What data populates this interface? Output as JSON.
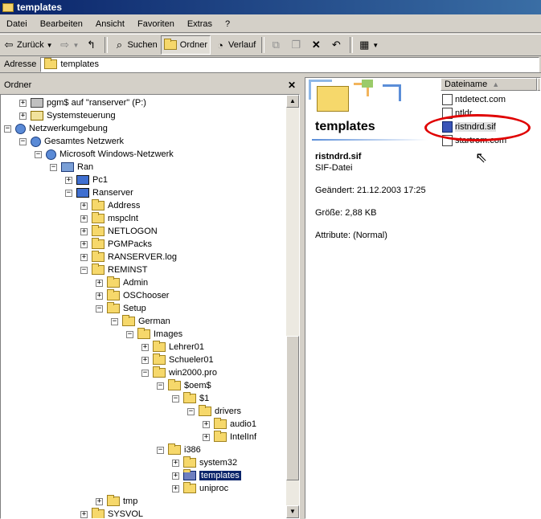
{
  "window": {
    "title": "templates"
  },
  "menu": [
    "Datei",
    "Bearbeiten",
    "Ansicht",
    "Favoriten",
    "Extras",
    "?"
  ],
  "toolbar": {
    "back": "Zurück",
    "search": "Suchen",
    "folders": "Ordner",
    "history": "Verlauf"
  },
  "address": {
    "label": "Adresse",
    "value": "templates"
  },
  "folders_pane": {
    "title": "Ordner",
    "items": [
      {
        "label": "pgm$ auf \"ranserver\" (P:)",
        "indent": 1,
        "expander": "+",
        "icon": "drive"
      },
      {
        "label": "Systemsteuerung",
        "indent": 1,
        "expander": "+",
        "icon": "control"
      },
      {
        "label": "Netzwerkumgebung",
        "indent": 0,
        "expander": "−",
        "icon": "network"
      },
      {
        "label": "Gesamtes Netzwerk",
        "indent": 1,
        "expander": "−",
        "icon": "network"
      },
      {
        "label": "Microsoft Windows-Netzwerk",
        "indent": 2,
        "expander": "−",
        "icon": "network"
      },
      {
        "label": "Ran",
        "indent": 3,
        "expander": "−",
        "icon": "group"
      },
      {
        "label": "Pc1",
        "indent": 4,
        "expander": "+",
        "icon": "pc"
      },
      {
        "label": "Ranserver",
        "indent": 4,
        "expander": "−",
        "icon": "pc"
      },
      {
        "label": "Address",
        "indent": 5,
        "expander": "+",
        "icon": "folder"
      },
      {
        "label": "mspclnt",
        "indent": 5,
        "expander": "+",
        "icon": "folder"
      },
      {
        "label": "NETLOGON",
        "indent": 5,
        "expander": "+",
        "icon": "folder"
      },
      {
        "label": "PGMPacks",
        "indent": 5,
        "expander": "+",
        "icon": "folder"
      },
      {
        "label": "RANSERVER.log",
        "indent": 5,
        "expander": "+",
        "icon": "folder"
      },
      {
        "label": "REMINST",
        "indent": 5,
        "expander": "−",
        "icon": "folder"
      },
      {
        "label": "Admin",
        "indent": 6,
        "expander": "+",
        "icon": "folder"
      },
      {
        "label": "OSChooser",
        "indent": 6,
        "expander": "+",
        "icon": "folder"
      },
      {
        "label": "Setup",
        "indent": 6,
        "expander": "−",
        "icon": "folder"
      },
      {
        "label": "German",
        "indent": 7,
        "expander": "−",
        "icon": "folder"
      },
      {
        "label": "Images",
        "indent": 8,
        "expander": "−",
        "icon": "folder"
      },
      {
        "label": "Lehrer01",
        "indent": 9,
        "expander": "+",
        "icon": "folder"
      },
      {
        "label": "Schueler01",
        "indent": 9,
        "expander": "+",
        "icon": "folder"
      },
      {
        "label": "win2000.pro",
        "indent": 9,
        "expander": "−",
        "icon": "folder"
      },
      {
        "label": "$oem$",
        "indent": 10,
        "expander": "−",
        "icon": "folder"
      },
      {
        "label": "$1",
        "indent": 11,
        "expander": "−",
        "icon": "folder"
      },
      {
        "label": "drivers",
        "indent": 12,
        "expander": "−",
        "icon": "folder"
      },
      {
        "label": "audio1",
        "indent": 13,
        "expander": "+",
        "icon": "folder"
      },
      {
        "label": "IntelInf",
        "indent": 13,
        "expander": "+",
        "icon": "folder"
      },
      {
        "label": "i386",
        "indent": 10,
        "expander": "−",
        "icon": "folder"
      },
      {
        "label": "system32",
        "indent": 11,
        "expander": "+",
        "icon": "folder"
      },
      {
        "label": "templates",
        "indent": 11,
        "expander": "+",
        "icon": "folder",
        "selected": true
      },
      {
        "label": "uniproc",
        "indent": 11,
        "expander": "+",
        "icon": "folder"
      },
      {
        "label": "tmp",
        "indent": 6,
        "expander": "+",
        "icon": "folder"
      },
      {
        "label": "SYSVOL",
        "indent": 5,
        "expander": "+",
        "icon": "folder"
      }
    ]
  },
  "detail": {
    "banner_title": "templates",
    "file_name": "ristndrd.sif",
    "file_type": "SIF-Datei",
    "changed": "Geändert: 21.12.2003 17:25",
    "size": "Größe: 2,88 KB",
    "attributes": "Attribute: (Normal)"
  },
  "file_list": {
    "column": "Dateiname",
    "files": [
      {
        "name": "ntdetect.com",
        "icon": "app"
      },
      {
        "name": "ntldr",
        "icon": "sys"
      },
      {
        "name": "ristndrd.sif",
        "icon": "sif",
        "selected": true
      },
      {
        "name": "startrom.com",
        "icon": "app"
      }
    ]
  },
  "colors": {
    "selection": "#0a246a",
    "annotation_circle": "#e00000",
    "face": "#d4d0c8"
  }
}
